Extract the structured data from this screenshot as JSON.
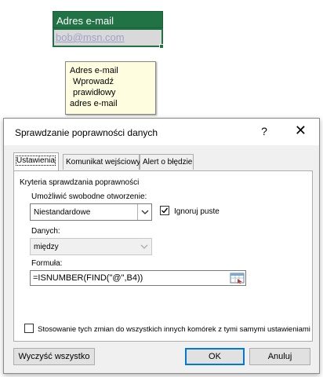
{
  "sheet": {
    "header_cell": "Adres e-mail",
    "active_cell": "bob@msn.com"
  },
  "tooltip": {
    "title": "Adres e-mail",
    "message_line1": "Wprowadź prawidłowy",
    "message_line2": "adres e-mail"
  },
  "dialog": {
    "title": "Sprawdzanie poprawności danych",
    "help_label": "?",
    "close_label": "✕",
    "tabs": [
      "Ustawienia",
      "Komunikat wejściowy",
      "Alert o błędzie"
    ],
    "criteria_label": "Kryteria sprawdzania poprawności",
    "allow_label": "Umożliwić swobodne otworzenie:",
    "allow_value": "Niestandardowe",
    "ignore_blank_label": "Ignoruj puste",
    "ignore_blank_checked": true,
    "data_label": "Danych:",
    "data_value": "między",
    "formula_label": "Formuła:",
    "formula_value": "=ISNUMBER(FIND(\"@\",B4))",
    "apply_all_label": "Stosowanie tych zmian do wszystkich innych komórek z tymi samymi ustawieniami",
    "apply_all_checked": false,
    "clear_all_label": "Wyczyść wszystko",
    "ok_label": "OK",
    "cancel_label": "Anuluj"
  },
  "colors": {
    "excel_green": "#217346",
    "tooltip_bg": "#fffde0",
    "dialog_bg": "#f0f0f0",
    "focus_blue": "#0078d7"
  }
}
